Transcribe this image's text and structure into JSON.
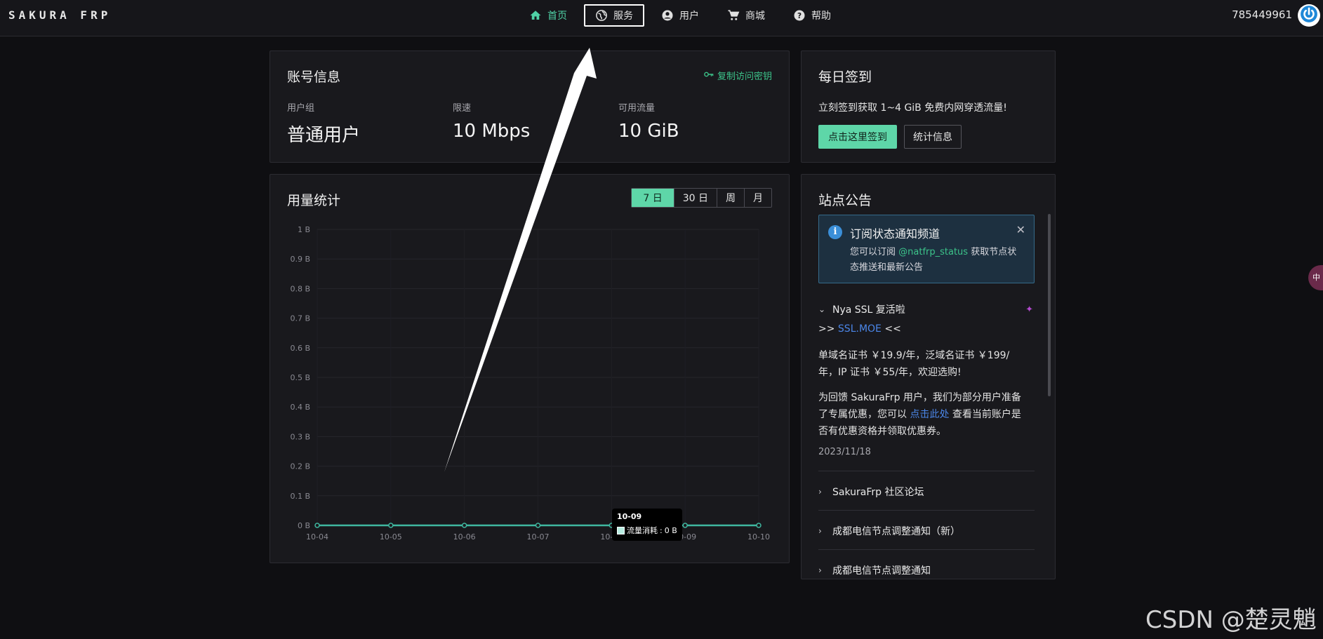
{
  "header": {
    "logo": "SAKURA FRP",
    "nav": [
      {
        "label": "首页",
        "icon": "home-icon",
        "active": true
      },
      {
        "label": "服务",
        "icon": "globe-icon",
        "boxed": true
      },
      {
        "label": "用户",
        "icon": "user-circle-icon"
      },
      {
        "label": "商城",
        "icon": "cart-icon"
      },
      {
        "label": "帮助",
        "icon": "help-circle-icon"
      }
    ],
    "user_id": "785449961",
    "power_icon": "power-icon"
  },
  "account": {
    "title": "账号信息",
    "copy_key_label": "复制访问密钥",
    "stats": [
      {
        "label": "用户组",
        "value": "普通用户"
      },
      {
        "label": "限速",
        "value": "10 Mbps"
      },
      {
        "label": "可用流量",
        "value": "10 GiB"
      }
    ]
  },
  "checkin": {
    "title": "每日签到",
    "text": "立刻签到获取 1~4 GiB 免费内网穿透流量!",
    "primary_label": "点击这里签到",
    "secondary_label": "统计信息"
  },
  "usage": {
    "title": "用量统计",
    "ranges": [
      "7 日",
      "30 日",
      "周",
      "月"
    ],
    "selected_range": "7 日",
    "tooltip": {
      "title": "10-09",
      "series": "流量消耗",
      "value": "0 B"
    }
  },
  "chart_data": {
    "type": "line",
    "x": [
      "10-04",
      "10-05",
      "10-06",
      "10-07",
      "10-08",
      "10-09",
      "10-10"
    ],
    "series": [
      {
        "name": "流量消耗",
        "values": [
          0,
          0,
          0,
          0,
          0,
          0,
          0
        ]
      }
    ],
    "yticks": [
      "0 B",
      "0.1 B",
      "0.2 B",
      "0.3 B",
      "0.4 B",
      "0.5 B",
      "0.6 B",
      "0.7 B",
      "0.8 B",
      "0.9 B",
      "1 B"
    ],
    "ylim": [
      0,
      1
    ],
    "grid": true,
    "line_color": "#3fb8a0"
  },
  "news": {
    "title": "站点公告",
    "notice": {
      "title": "订阅状态通知频道",
      "body_prefix": "您可以订阅 ",
      "body_link": "@natfrp_status",
      "body_suffix": " 获取节点状态推送和最新公告"
    },
    "expanded_item": {
      "title": "Nya SSL 复活啦",
      "line1_prefix": ">> ",
      "line1_link": "SSL.MOE",
      "line1_suffix": " <<",
      "para1": "单域名证书 ￥19.9/年，泛域名证书 ￥199/年，IP 证书 ￥55/年，欢迎选购!",
      "para2_prefix": "为回馈 SakuraFrp 用户，我们为部分用户准备了专属优惠，您可以 ",
      "para2_link": "点击此处",
      "para2_suffix": " 查看当前账户是否有优惠资格并领取优惠券。",
      "date": "2023/11/18"
    },
    "items": [
      "SakuraFrp 社区论坛",
      "成都电信节点调整通知（新）",
      "成都电信节点调整通知"
    ]
  },
  "side_float": "中",
  "watermark": "CSDN @楚灵魈"
}
